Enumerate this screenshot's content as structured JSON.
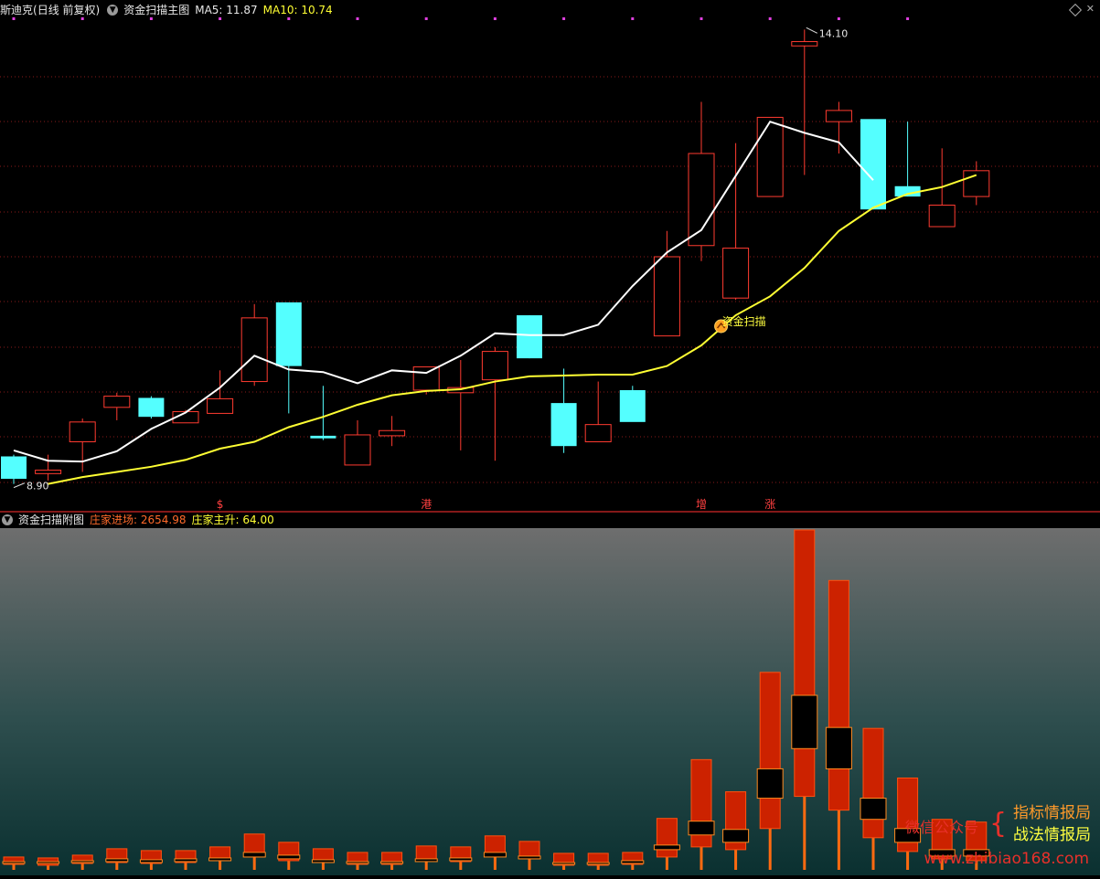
{
  "main_panel": {
    "stock_name": "斯迪克",
    "period": "(日线 前复权)",
    "indicator_name": "资金扫描主图",
    "ma5_label": "MA5: 11.87",
    "ma10_label": "MA10: 10.74",
    "high_label": "14.10",
    "low_label": "8.90",
    "signal_label": "资金扫描",
    "markers": [
      {
        "index": 6,
        "text": "$"
      },
      {
        "index": 12,
        "text": "港"
      },
      {
        "index": 20,
        "text": "增"
      },
      {
        "index": 22,
        "text": "涨"
      }
    ]
  },
  "sub_panel": {
    "indicator_name": "资金扫描附图",
    "value1_label": "庄家进场: 2654.98",
    "value2_label": "庄家主升: 64.00"
  },
  "watermark": {
    "left_text": "微信公众号",
    "brace": "{",
    "line1": "指标情报局",
    "line2": "战法情报局",
    "url": "www.zhibiao168.com"
  },
  "colors": {
    "up": "#ff3b30",
    "down": "#54ffff",
    "ma5": "#ffffff",
    "ma10": "#ffff33",
    "grid": "#8a1a1a",
    "sub_bar": "#cc2200",
    "sub_wick": "#ff6a10",
    "signal_dots": "#e040e0"
  },
  "chart_data": [
    {
      "type": "candlestick",
      "x": [
        0,
        1,
        2,
        3,
        4,
        5,
        6,
        7,
        8,
        9,
        10,
        11,
        12,
        13,
        14,
        15,
        16,
        17,
        18,
        19,
        20,
        21,
        22,
        23,
        24,
        25,
        26,
        27,
        28
      ],
      "open": [
        9.18,
        8.98,
        9.35,
        9.75,
        9.86,
        9.57,
        9.68,
        10.05,
        10.97,
        9.42,
        9.08,
        9.42,
        9.95,
        9.92,
        10.07,
        10.82,
        9.8,
        9.35,
        9.95,
        10.58,
        11.63,
        11.02,
        12.2,
        13.95,
        13.07,
        13.1,
        12.32,
        11.85,
        12.2
      ],
      "close": [
        8.92,
        9.02,
        9.58,
        9.88,
        9.64,
        9.7,
        9.85,
        10.79,
        10.23,
        9.39,
        9.43,
        9.48,
        10.22,
        9.98,
        10.4,
        10.32,
        9.3,
        9.55,
        9.58,
        11.5,
        12.7,
        11.6,
        13.12,
        14.0,
        13.2,
        12.05,
        12.2,
        12.1,
        12.5
      ],
      "high": [
        9.2,
        9.2,
        9.62,
        9.92,
        9.88,
        9.72,
        10.18,
        10.95,
        10.95,
        10.0,
        9.6,
        9.65,
        10.22,
        10.3,
        10.45,
        10.82,
        10.2,
        10.05,
        10.0,
        11.8,
        13.3,
        12.82,
        13.12,
        14.14,
        13.3,
        12.55,
        13.07,
        12.76,
        12.61
      ],
      "low": [
        8.86,
        8.9,
        9.0,
        9.6,
        9.62,
        9.57,
        9.68,
        10.0,
        9.68,
        9.37,
        9.08,
        9.3,
        9.9,
        9.25,
        9.13,
        10.32,
        9.22,
        9.45,
        9.6,
        10.58,
        11.45,
        11.0,
        12.2,
        12.45,
        12.7,
        12.05,
        12.2,
        12.1,
        12.1
      ],
      "series": [
        {
          "name": "MA5",
          "values": [
            9.25,
            9.13,
            9.12,
            9.24,
            9.5,
            9.69,
            9.98,
            10.35,
            10.19,
            10.16,
            10.03,
            10.18,
            10.15,
            10.35,
            10.61,
            10.59,
            10.59,
            10.71,
            11.16,
            11.55,
            11.81,
            12.44,
            13.07,
            12.94,
            12.83,
            12.39
          ]
        },
        {
          "name": "MA10",
          "values": [
            8.86,
            8.94,
            9.0,
            9.06,
            9.14,
            9.27,
            9.35,
            9.52,
            9.64,
            9.78,
            9.89,
            9.94,
            9.96,
            10.05,
            10.11,
            10.12,
            10.13,
            10.13,
            10.23,
            10.47,
            10.82,
            11.04,
            11.37,
            11.8,
            12.07,
            12.23,
            12.31,
            12.45
          ]
        },
        {
          "name": "MA10_start_index",
          "values": [
            1
          ]
        }
      ],
      "ylim": [
        8.75,
        14.25
      ]
    },
    {
      "type": "bar",
      "x": [
        0,
        1,
        2,
        3,
        4,
        5,
        6,
        7,
        8,
        9,
        10,
        11,
        12,
        13,
        14,
        15,
        16,
        17,
        18,
        19,
        20,
        21,
        22,
        23,
        24,
        25,
        26,
        27,
        28
      ],
      "series": [
        {
          "name": "bar_top",
          "values": [
            14,
            13,
            16,
            23,
            21,
            21,
            25,
            39,
            30,
            23,
            19,
            19,
            26,
            25,
            37,
            31,
            18,
            18,
            19,
            56,
            120,
            85,
            215,
            370,
            315,
            154,
            100,
            55,
            52
          ]
        },
        {
          "name": "bar_bottom",
          "values": [
            6,
            5,
            7,
            8,
            7,
            8,
            10,
            14,
            10,
            8,
            6,
            6,
            10,
            9,
            15,
            12,
            5,
            5,
            6,
            14,
            25,
            22,
            45,
            80,
            65,
            35,
            20,
            12,
            10
          ]
        },
        {
          "name": "box_top",
          "values": [
            9,
            9,
            10,
            12,
            11,
            12,
            13,
            19,
            16,
            11,
            9,
            9,
            12,
            13,
            19,
            15,
            8,
            8,
            10,
            27,
            53,
            44,
            110,
            190,
            155,
            78,
            45,
            22,
            22
          ]
        },
        {
          "name": "box_bottom",
          "values": [
            7,
            7,
            8,
            9,
            8,
            9,
            10,
            14,
            12,
            8,
            7,
            7,
            9,
            10,
            14,
            12,
            6,
            6,
            7,
            22,
            38,
            30,
            78,
            132,
            110,
            55,
            30,
            15,
            15
          ]
        }
      ],
      "ylim": [
        0,
        372
      ]
    }
  ]
}
